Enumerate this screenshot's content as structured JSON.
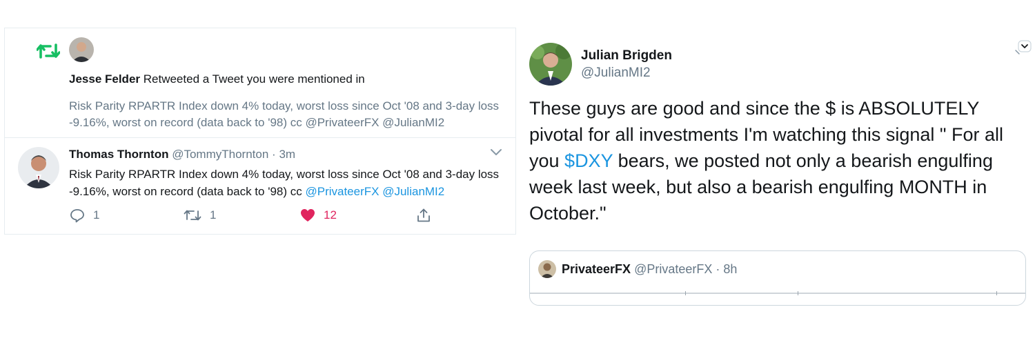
{
  "notification": {
    "retweeter_name": "Jesse Felder",
    "action_text": "Retweeted a Tweet you were mentioned in",
    "quote_text": "Risk Parity RPARTR Index down 4% today, worst loss since Oct '08 and 3-day loss -9.16%, worst on record (data back to '98) cc @PrivateerFX @JulianMI2"
  },
  "tweet": {
    "author_name": "Thomas Thornton",
    "author_handle": "@TommyThornton",
    "separator": "·",
    "time": "3m",
    "text": "Risk Parity RPARTR Index down 4% today, worst loss since Oct '08 and 3-day loss -9.16%, worst on record (data back to '98) cc ",
    "mention_1": "@PrivateerFX",
    "mention_2": "@JulianMI2",
    "reply_count": "1",
    "retweet_count": "1",
    "like_count": "12"
  },
  "right_tweet": {
    "author_name": "Julian Brigden",
    "author_handle": "@JulianMI2",
    "text_part1": "These guys are good and since the $ is ABSOLUTELY pivotal for all investments I'm watching this signal \" For all you ",
    "cashtag": "$DXY",
    "text_part2": " bears,  we posted not only a bearish engulfing week last week, but also a bearish engulfing MONTH in October.\"",
    "quoted": {
      "author_name": "PrivateerFX",
      "author_handle": "@PrivateerFX",
      "separator": "·",
      "time": "8h"
    }
  },
  "colors": {
    "retweet_green": "#17bf63",
    "like_red": "#e0245e",
    "link_blue": "#1b95e0",
    "muted_gray": "#657786"
  },
  "icons": [
    "retweet-icon",
    "chevron-down-icon",
    "reply-icon",
    "like-heart-icon",
    "share-icon"
  ]
}
